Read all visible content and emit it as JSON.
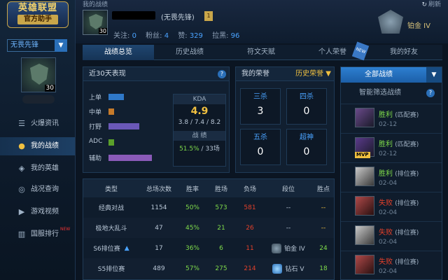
{
  "app": {
    "logo_line1": "英雄联盟",
    "logo_line2": "官方助手"
  },
  "sidebar": {
    "server": "无畏先锋",
    "level": "30",
    "items": [
      {
        "label": "火爆资讯",
        "icon": "document-icon"
      },
      {
        "label": "我的战绩",
        "icon": "person-icon",
        "active": true
      },
      {
        "label": "我的英雄",
        "icon": "shield-icon"
      },
      {
        "label": "战况查询",
        "icon": "search-icon"
      },
      {
        "label": "游戏视频",
        "icon": "play-icon"
      },
      {
        "label": "国服排行",
        "icon": "chart-icon",
        "badge": "NEW"
      }
    ]
  },
  "header": {
    "breadcrumb": "我的战绩",
    "refresh": "刷新",
    "level": "30",
    "player_title": "(无畏先锋)",
    "stats": {
      "follow_label": "关注:",
      "follow": "0",
      "fans_label": "粉丝:",
      "fans": "4",
      "likes_label": "赞:",
      "likes": "329",
      "dislikes_label": "拉黑:",
      "dislikes": "96"
    },
    "rank": "铂金 IV"
  },
  "tabs": [
    "战绩总览",
    "历史战绩",
    "符文天赋",
    "个人荣誉",
    "我的好友"
  ],
  "tab_new_tag": "NEW",
  "recent": {
    "title": "近30天表现",
    "roles": [
      {
        "label": "上单",
        "value": 0.26,
        "color": "#2f78c8"
      },
      {
        "label": "中单",
        "value": 0.1,
        "color": "#c67a2a"
      },
      {
        "label": "打野",
        "value": 0.52,
        "color": "#6a58b8"
      },
      {
        "label": "ADC",
        "value": 0.1,
        "color": "#5aa02a"
      },
      {
        "label": "辅助",
        "value": 0.74,
        "color": "#8a5ab8"
      }
    ],
    "kda_label": "KDA",
    "kda_value": "4.9",
    "kda_detail": "3.8 / 7.4 / 8.2",
    "record_label": "战 绩",
    "winrate": "51.5%",
    "games": "/ 33场"
  },
  "honor": {
    "title": "我的荣誉",
    "select": "历史荣誉",
    "items": [
      {
        "label": "三杀",
        "value": "3"
      },
      {
        "label": "四杀",
        "value": "0"
      },
      {
        "label": "五杀",
        "value": "0"
      },
      {
        "label": "超神",
        "value": "0"
      }
    ]
  },
  "table": {
    "headers": [
      "类型",
      "总场次数",
      "胜率",
      "胜场",
      "负场",
      "段位",
      "胜点"
    ],
    "rows": [
      {
        "type": "经典对战",
        "total": "1154",
        "rate": "50%",
        "wins": "573",
        "losses": "581",
        "tier": "--",
        "points": "--"
      },
      {
        "type": "极地大乱斗",
        "total": "47",
        "rate": "45%",
        "wins": "21",
        "losses": "26",
        "tier": "--",
        "points": "--"
      },
      {
        "type": "S6排位赛",
        "total": "17",
        "rate": "36%",
        "wins": "6",
        "losses": "11",
        "tier": "铂金 IV",
        "points": "24"
      },
      {
        "type": "S5排位赛",
        "total": "489",
        "rate": "57%",
        "wins": "275",
        "losses": "214",
        "tier": "钻石 V",
        "points": "18"
      }
    ]
  },
  "records": {
    "all": "全部战绩",
    "smart": "智能筛选战绩",
    "items": [
      {
        "result": "胜利",
        "mode": "(匹配赛)",
        "date": "02-12",
        "win": true
      },
      {
        "result": "胜利",
        "mode": "(匹配赛)",
        "date": "02-12",
        "win": true,
        "badge": "MVP"
      },
      {
        "result": "胜利",
        "mode": "(排位赛)",
        "date": "02-04",
        "win": true
      },
      {
        "result": "失败",
        "mode": "(排位赛)",
        "date": "02-04",
        "win": false
      },
      {
        "result": "失败",
        "mode": "(排位赛)",
        "date": "02-04",
        "win": false
      },
      {
        "result": "失败",
        "mode": "(排位赛)",
        "date": "02-04",
        "win": false
      }
    ]
  },
  "colors": {
    "accent": "#4aa3ff",
    "win": "#7fdc4a",
    "loss": "#e3402a",
    "gold": "#f0c040"
  }
}
